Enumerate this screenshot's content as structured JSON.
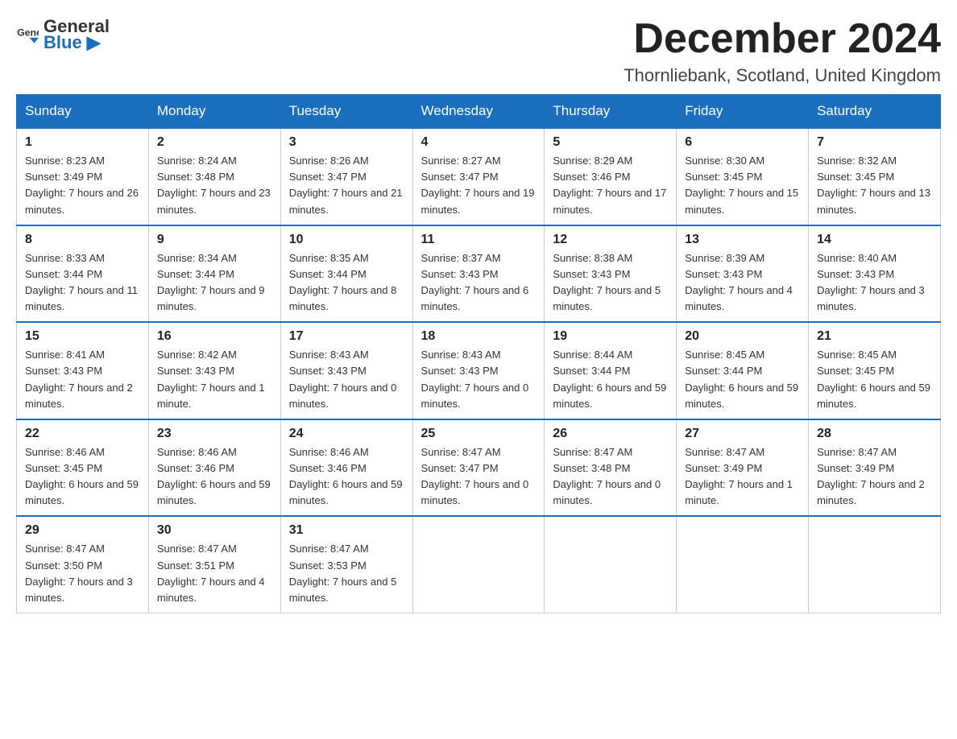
{
  "header": {
    "logo_text_general": "General",
    "logo_text_blue": "Blue",
    "month_title": "December 2024",
    "location": "Thornliebank, Scotland, United Kingdom"
  },
  "days_of_week": [
    "Sunday",
    "Monday",
    "Tuesday",
    "Wednesday",
    "Thursday",
    "Friday",
    "Saturday"
  ],
  "weeks": [
    [
      {
        "day": "1",
        "sunrise": "8:23 AM",
        "sunset": "3:49 PM",
        "daylight": "7 hours and 26 minutes."
      },
      {
        "day": "2",
        "sunrise": "8:24 AM",
        "sunset": "3:48 PM",
        "daylight": "7 hours and 23 minutes."
      },
      {
        "day": "3",
        "sunrise": "8:26 AM",
        "sunset": "3:47 PM",
        "daylight": "7 hours and 21 minutes."
      },
      {
        "day": "4",
        "sunrise": "8:27 AM",
        "sunset": "3:47 PM",
        "daylight": "7 hours and 19 minutes."
      },
      {
        "day": "5",
        "sunrise": "8:29 AM",
        "sunset": "3:46 PM",
        "daylight": "7 hours and 17 minutes."
      },
      {
        "day": "6",
        "sunrise": "8:30 AM",
        "sunset": "3:45 PM",
        "daylight": "7 hours and 15 minutes."
      },
      {
        "day": "7",
        "sunrise": "8:32 AM",
        "sunset": "3:45 PM",
        "daylight": "7 hours and 13 minutes."
      }
    ],
    [
      {
        "day": "8",
        "sunrise": "8:33 AM",
        "sunset": "3:44 PM",
        "daylight": "7 hours and 11 minutes."
      },
      {
        "day": "9",
        "sunrise": "8:34 AM",
        "sunset": "3:44 PM",
        "daylight": "7 hours and 9 minutes."
      },
      {
        "day": "10",
        "sunrise": "8:35 AM",
        "sunset": "3:44 PM",
        "daylight": "7 hours and 8 minutes."
      },
      {
        "day": "11",
        "sunrise": "8:37 AM",
        "sunset": "3:43 PM",
        "daylight": "7 hours and 6 minutes."
      },
      {
        "day": "12",
        "sunrise": "8:38 AM",
        "sunset": "3:43 PM",
        "daylight": "7 hours and 5 minutes."
      },
      {
        "day": "13",
        "sunrise": "8:39 AM",
        "sunset": "3:43 PM",
        "daylight": "7 hours and 4 minutes."
      },
      {
        "day": "14",
        "sunrise": "8:40 AM",
        "sunset": "3:43 PM",
        "daylight": "7 hours and 3 minutes."
      }
    ],
    [
      {
        "day": "15",
        "sunrise": "8:41 AM",
        "sunset": "3:43 PM",
        "daylight": "7 hours and 2 minutes."
      },
      {
        "day": "16",
        "sunrise": "8:42 AM",
        "sunset": "3:43 PM",
        "daylight": "7 hours and 1 minute."
      },
      {
        "day": "17",
        "sunrise": "8:43 AM",
        "sunset": "3:43 PM",
        "daylight": "7 hours and 0 minutes."
      },
      {
        "day": "18",
        "sunrise": "8:43 AM",
        "sunset": "3:43 PM",
        "daylight": "7 hours and 0 minutes."
      },
      {
        "day": "19",
        "sunrise": "8:44 AM",
        "sunset": "3:44 PM",
        "daylight": "6 hours and 59 minutes."
      },
      {
        "day": "20",
        "sunrise": "8:45 AM",
        "sunset": "3:44 PM",
        "daylight": "6 hours and 59 minutes."
      },
      {
        "day": "21",
        "sunrise": "8:45 AM",
        "sunset": "3:45 PM",
        "daylight": "6 hours and 59 minutes."
      }
    ],
    [
      {
        "day": "22",
        "sunrise": "8:46 AM",
        "sunset": "3:45 PM",
        "daylight": "6 hours and 59 minutes."
      },
      {
        "day": "23",
        "sunrise": "8:46 AM",
        "sunset": "3:46 PM",
        "daylight": "6 hours and 59 minutes."
      },
      {
        "day": "24",
        "sunrise": "8:46 AM",
        "sunset": "3:46 PM",
        "daylight": "6 hours and 59 minutes."
      },
      {
        "day": "25",
        "sunrise": "8:47 AM",
        "sunset": "3:47 PM",
        "daylight": "7 hours and 0 minutes."
      },
      {
        "day": "26",
        "sunrise": "8:47 AM",
        "sunset": "3:48 PM",
        "daylight": "7 hours and 0 minutes."
      },
      {
        "day": "27",
        "sunrise": "8:47 AM",
        "sunset": "3:49 PM",
        "daylight": "7 hours and 1 minute."
      },
      {
        "day": "28",
        "sunrise": "8:47 AM",
        "sunset": "3:49 PM",
        "daylight": "7 hours and 2 minutes."
      }
    ],
    [
      {
        "day": "29",
        "sunrise": "8:47 AM",
        "sunset": "3:50 PM",
        "daylight": "7 hours and 3 minutes."
      },
      {
        "day": "30",
        "sunrise": "8:47 AM",
        "sunset": "3:51 PM",
        "daylight": "7 hours and 4 minutes."
      },
      {
        "day": "31",
        "sunrise": "8:47 AM",
        "sunset": "3:53 PM",
        "daylight": "7 hours and 5 minutes."
      },
      null,
      null,
      null,
      null
    ]
  ]
}
